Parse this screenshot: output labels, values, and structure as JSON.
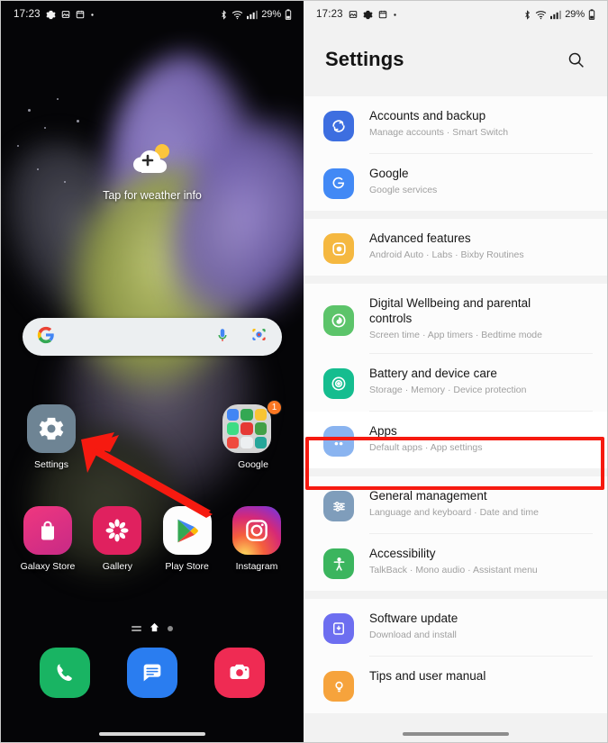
{
  "status_bar": {
    "time": "17:23",
    "left_icons": [
      "gear-icon",
      "photo-icon",
      "calendar-icon",
      "dot-icon"
    ],
    "right_icons": [
      "bluetooth-icon",
      "wifi-icon",
      "signal-icon"
    ],
    "battery": "29%"
  },
  "home": {
    "weather_widget": {
      "label": "Tap for weather info",
      "icon": "cloud-sun-add-icon"
    },
    "search_widget": {
      "logo": "google-g-icon",
      "mic": "microphone-icon",
      "lens": "google-lens-icon"
    },
    "apps_row1": [
      {
        "label": "Settings",
        "icon": "gear-icon",
        "badge": ""
      },
      {
        "label": "Google",
        "icon": "folder-icon",
        "badge": "1"
      }
    ],
    "apps_row2": [
      {
        "label": "Galaxy Store",
        "icon": "shopping-bag-icon"
      },
      {
        "label": "Gallery",
        "icon": "flower-icon"
      },
      {
        "label": "Play Store",
        "icon": "play-triangle-icon"
      },
      {
        "label": "Instagram",
        "icon": "instagram-camera-icon"
      }
    ],
    "dock": [
      {
        "label": "Phone",
        "icon": "phone-icon"
      },
      {
        "label": "Messages",
        "icon": "message-icon"
      },
      {
        "label": "Camera",
        "icon": "camera-icon"
      }
    ]
  },
  "settings": {
    "title": "Settings",
    "search_icon": "search-icon",
    "highlight_color": "#f61a10",
    "groups": [
      {
        "items": [
          {
            "title": "Accounts and backup",
            "subtitle": "Manage accounts  ·  Smart Switch",
            "icon": "sync-accounts-icon",
            "icon_color": "#3d6ee0",
            "highlighted": false
          },
          {
            "title": "Google",
            "subtitle": "Google services",
            "icon": "google-g-icon",
            "icon_color": "#4289f5",
            "highlighted": false
          }
        ]
      },
      {
        "items": [
          {
            "title": "Advanced features",
            "subtitle": "Android Auto  ·  Labs  ·  Bixby Routines",
            "icon": "advanced-features-icon",
            "icon_color": "#f5b840",
            "highlighted": false
          }
        ]
      },
      {
        "items": [
          {
            "title": "Digital Wellbeing and parental controls",
            "subtitle": "Screen time  ·  App timers  ·  Bedtime mode",
            "icon": "wellbeing-icon",
            "icon_color": "#5cc46a",
            "highlighted": false
          },
          {
            "title": "Battery and device care",
            "subtitle": "Storage  ·  Memory  ·  Device protection",
            "icon": "device-care-icon",
            "icon_color": "#15bd8f",
            "highlighted": false
          },
          {
            "title": "Apps",
            "subtitle": "Default apps  ·  App settings",
            "icon": "apps-grid-icon",
            "icon_color": "#8ab4f0",
            "highlighted": true
          }
        ]
      },
      {
        "items": [
          {
            "title": "General management",
            "subtitle": "Language and keyboard  ·  Date and time",
            "icon": "sliders-icon",
            "icon_color": "#7f9dbb",
            "highlighted": false
          },
          {
            "title": "Accessibility",
            "subtitle": "TalkBack  ·  Mono audio  ·  Assistant menu",
            "icon": "accessibility-icon",
            "icon_color": "#3bb55e",
            "highlighted": false
          }
        ]
      },
      {
        "items": [
          {
            "title": "Software update",
            "subtitle": "Download and install",
            "icon": "software-update-icon",
            "icon_color": "#6d6ef0",
            "highlighted": false
          },
          {
            "title": "Tips and user manual",
            "subtitle": "",
            "icon": "tips-icon",
            "icon_color": "#f6a33c",
            "highlighted": false
          }
        ]
      }
    ]
  }
}
